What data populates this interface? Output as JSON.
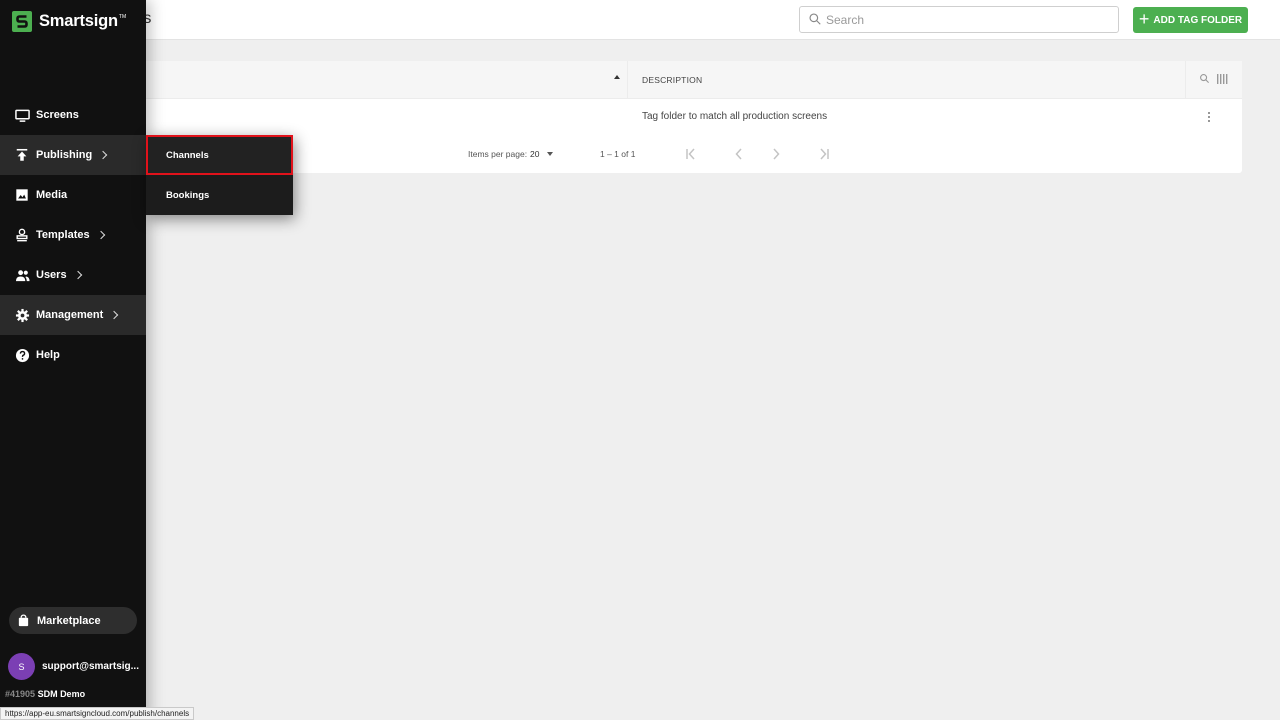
{
  "header": {
    "page_title": "rs",
    "search_placeholder": "Search",
    "add_button_label": "ADD TAG FOLDER"
  },
  "table": {
    "columns": {
      "description": "DESCRIPTION"
    },
    "rows": [
      {
        "description": "Tag folder to match all production screens"
      }
    ],
    "paginator": {
      "items_per_page_label": "Items per page:",
      "items_per_page_value": "20",
      "range_label": "1 – 1 of 1"
    }
  },
  "sidebar": {
    "brand": "Smartsign",
    "brand_tm": "TM",
    "items": [
      {
        "label": "Screens",
        "icon": "monitor-icon"
      },
      {
        "label": "Publishing",
        "icon": "upload-icon"
      },
      {
        "label": "Media",
        "icon": "image-icon"
      },
      {
        "label": "Templates",
        "icon": "stamp-icon"
      },
      {
        "label": "Users",
        "icon": "users-icon"
      },
      {
        "label": "Management",
        "icon": "gear-icon"
      },
      {
        "label": "Help",
        "icon": "help-icon"
      }
    ],
    "marketplace_label": "Marketplace",
    "user": {
      "avatar_initial": "S",
      "email": "support@smartsig..."
    },
    "account": {
      "id": "#41905",
      "name": "SDM Demo"
    }
  },
  "submenu": {
    "items": [
      {
        "label": "Channels"
      },
      {
        "label": "Bookings"
      }
    ]
  },
  "status_bar": {
    "url": "https://app-eu.smartsigncloud.com/publish/channels"
  },
  "colors": {
    "accent_green": "#4caf50",
    "sidebar_bg": "#111111",
    "highlight_red": "#e1121b",
    "avatar_purple": "#7b3fb4"
  }
}
